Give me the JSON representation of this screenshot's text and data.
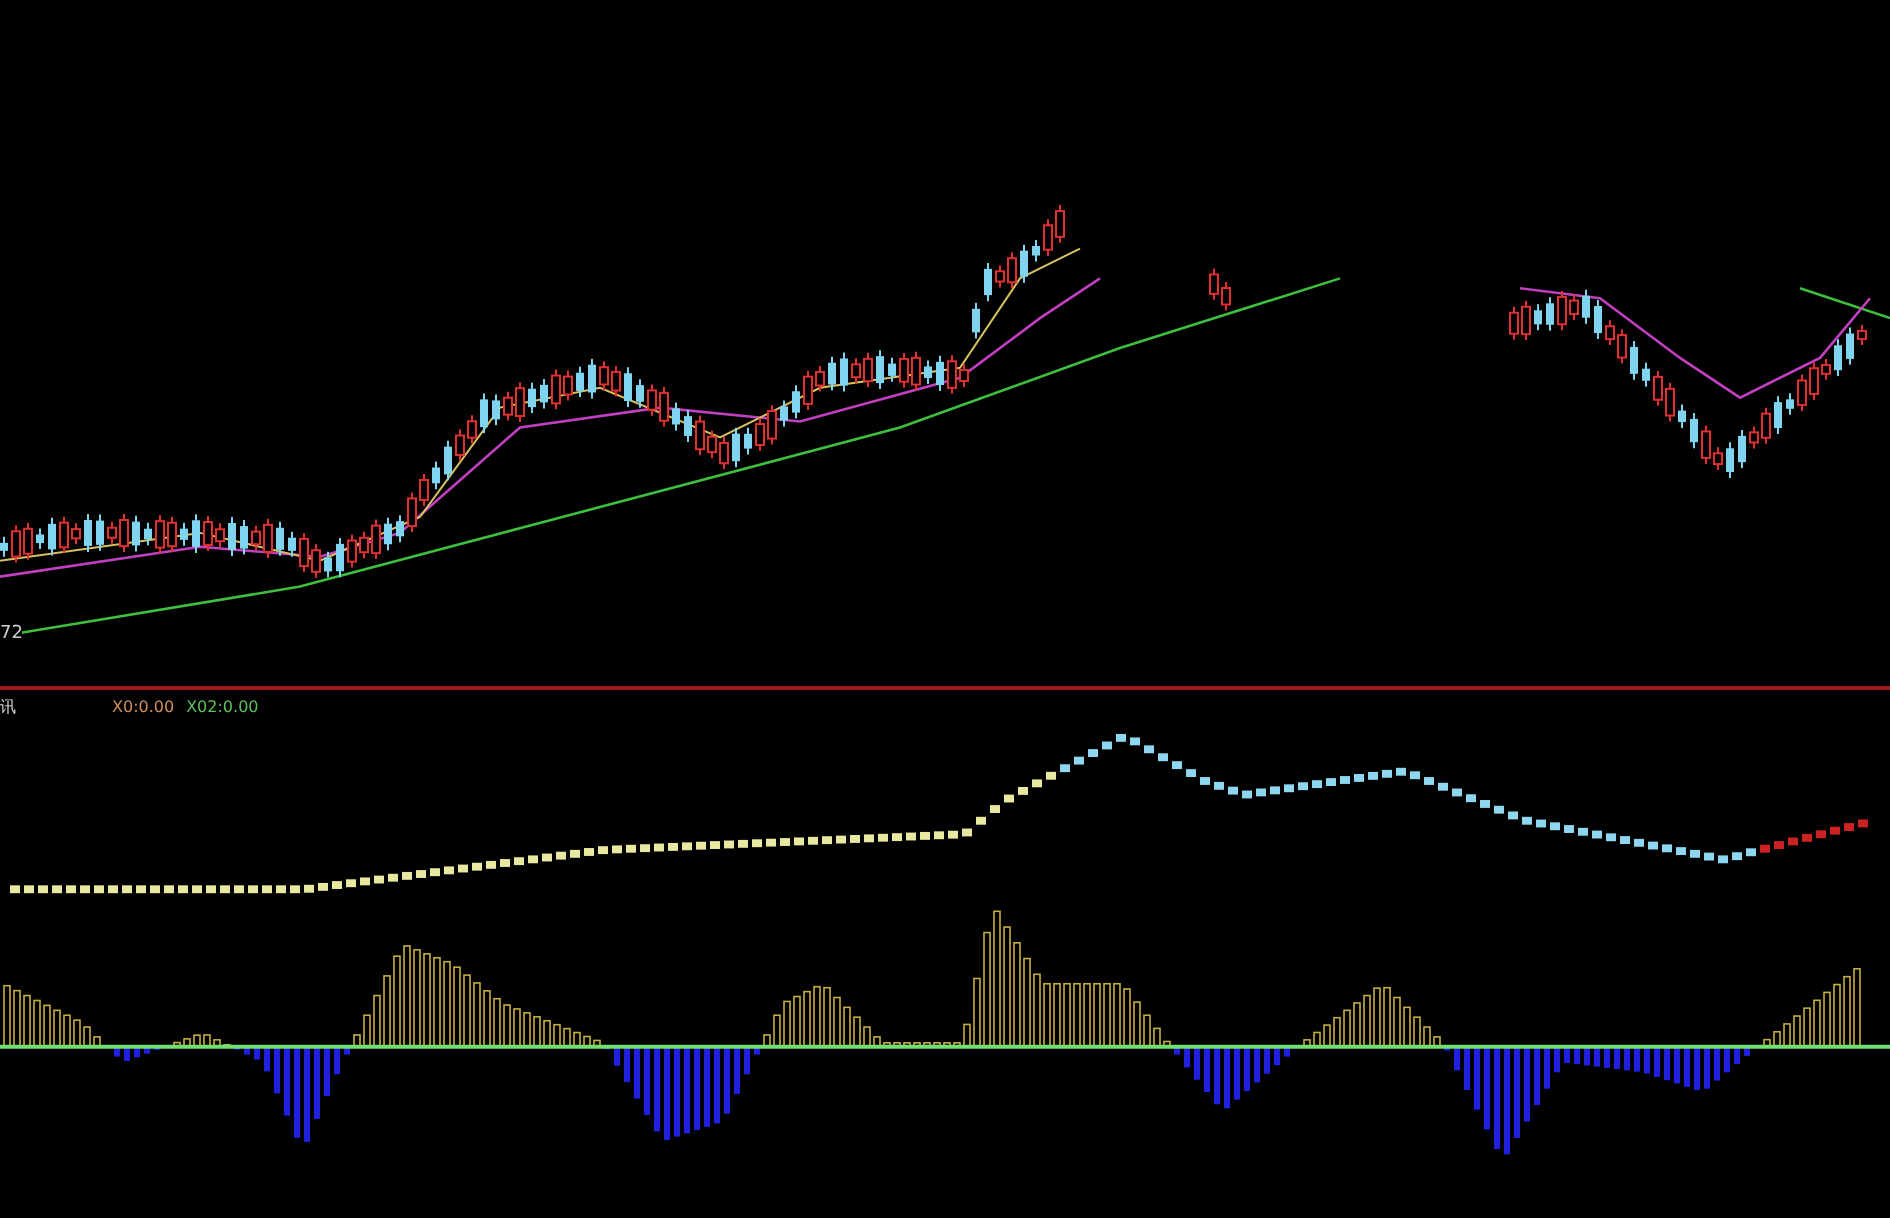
{
  "price_panel": {
    "axis_label": "72"
  },
  "indicator_header": {
    "title": "讯",
    "x0": "X0:0.00",
    "x02": "X02:0.00"
  }
}
